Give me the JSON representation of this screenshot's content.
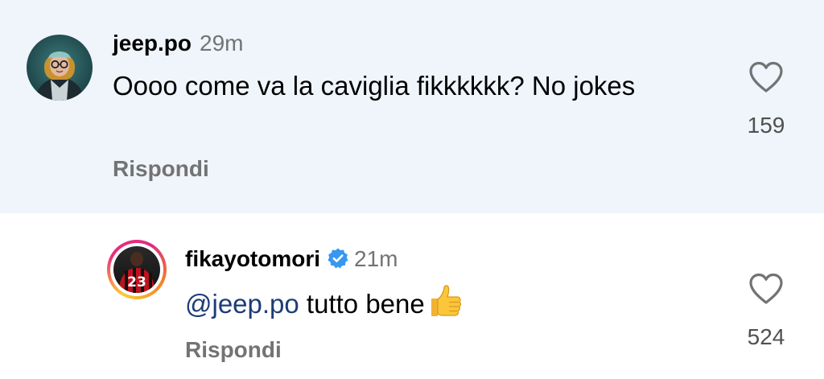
{
  "comments": [
    {
      "username": "jeep.po",
      "time": "29m",
      "text": "Oooo come va la caviglia fikkkkkk? No jokes",
      "reply_label": "Rispondi",
      "likes": "159",
      "highlighted": true,
      "highlight_color": "#eff5fb"
    },
    {
      "username": "fikayotomori",
      "verified": true,
      "time": "21m",
      "mention": "@jeep.po",
      "text": " tutto bene",
      "emoji": "thumbs-up",
      "reply_label": "Rispondi",
      "likes": "524",
      "is_reply": true,
      "mention_color": "#1c3c78"
    }
  ],
  "icons": {
    "like": "heart-outline-icon",
    "verified": "verified-badge-icon"
  }
}
